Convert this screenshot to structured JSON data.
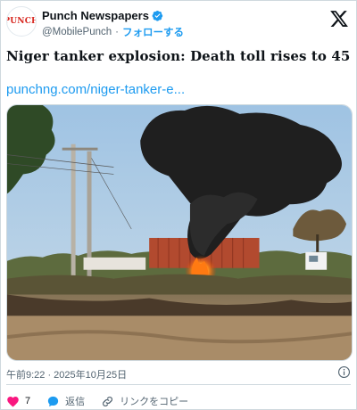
{
  "account": {
    "display_name": "Punch Newspapers",
    "handle": "@MobilePunch",
    "separator": "·",
    "follow_label": "フォローする",
    "avatar_text": "PUNCH"
  },
  "tweet": {
    "text": "Niger tanker explosion: Death toll rises to 45",
    "link": "punchng.com/niger-tanker-e...",
    "timestamp": "午前9:22 · 2025年10月25日"
  },
  "actions": {
    "like_count": "7",
    "reply_label": "返信",
    "copy_link_label": "リンクをコピー"
  },
  "colors": {
    "accent": "#1d9bf0",
    "like": "#f91880",
    "text": "#0f1419",
    "secondary": "#536471",
    "brand_red": "#d7261e"
  },
  "icons": [
    "verified-badge-icon",
    "x-logo-icon",
    "info-icon",
    "heart-icon",
    "reply-icon",
    "link-icon"
  ]
}
